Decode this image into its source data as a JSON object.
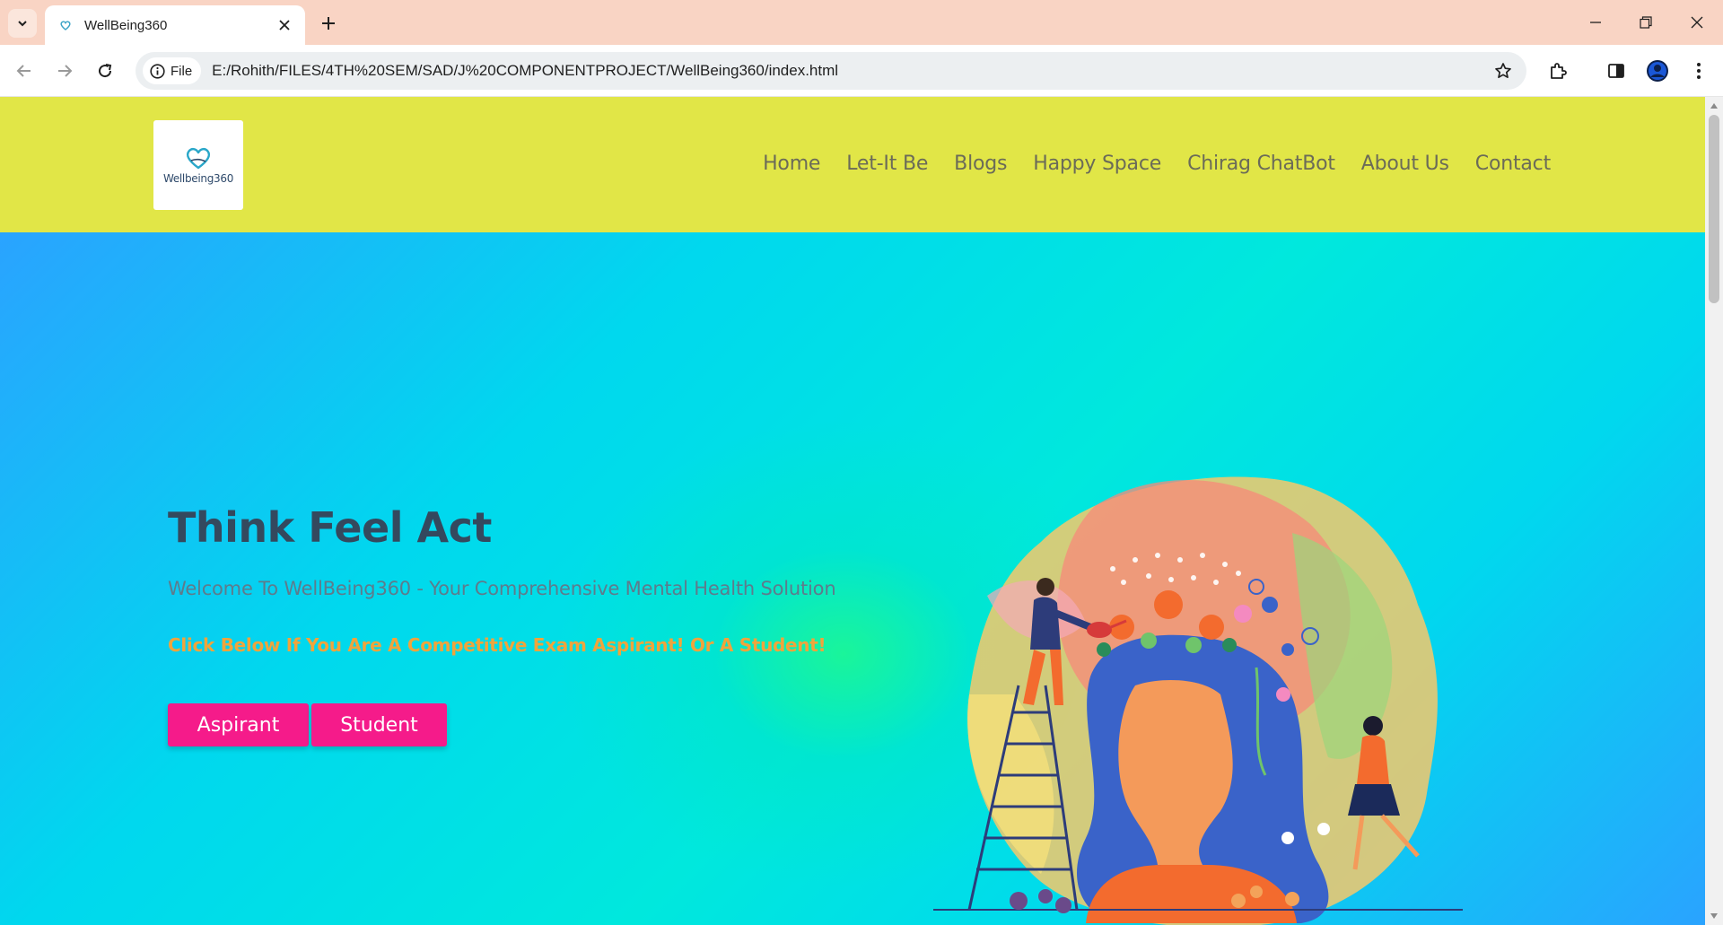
{
  "browser": {
    "tab": {
      "title": "WellBeing360"
    },
    "address": {
      "chip_label": "File",
      "url": "E:/Rohith/FILES/4TH%20SEM/SAD/J%20COMPONENTPROJECT/WellBeing360/index.html"
    }
  },
  "site": {
    "logo": {
      "text": "Wellbeing360"
    },
    "nav": [
      {
        "label": "Home"
      },
      {
        "label": "Let-It Be"
      },
      {
        "label": "Blogs"
      },
      {
        "label": "Happy Space"
      },
      {
        "label": "Chirag ChatBot"
      },
      {
        "label": "About Us"
      },
      {
        "label": "Contact"
      }
    ],
    "hero": {
      "title": "Think Feel Act",
      "subtitle": "Welcome To WellBeing360 - Your Comprehensive Mental Health Solution",
      "cta_text": "Click Below If You Are A Competitive Exam Aspirant! Or A Student!",
      "buttons": {
        "aspirant": "Aspirant",
        "student": "Student"
      }
    }
  },
  "colors": {
    "tabstrip": "#f9d4c4",
    "header": "#e1e647",
    "button": "#f51b8a",
    "title": "#34495e",
    "cta": "#f0a43c"
  }
}
